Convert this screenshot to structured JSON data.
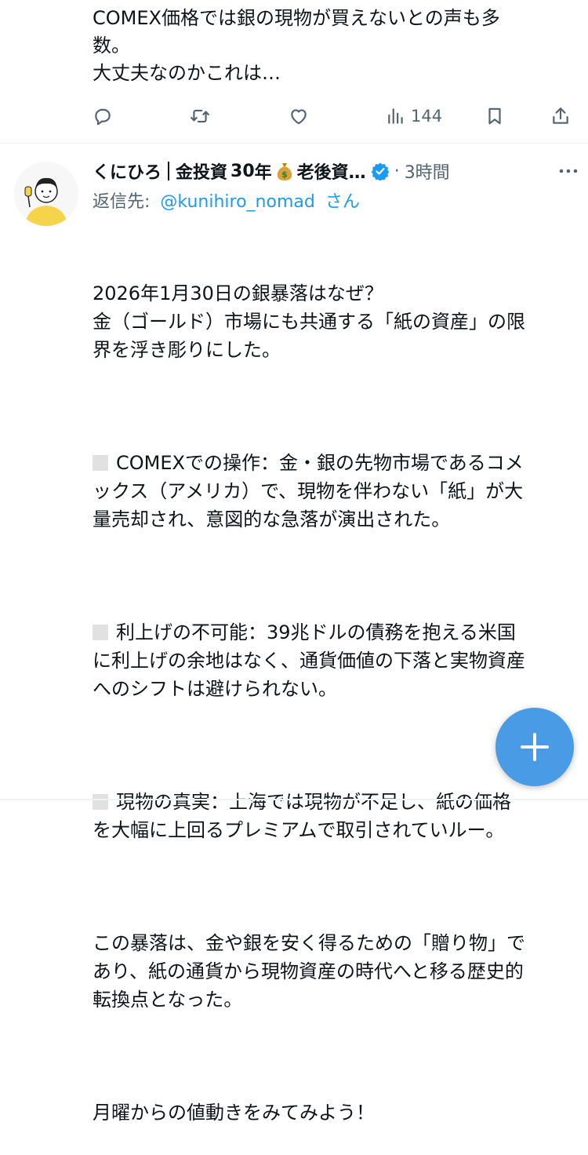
{
  "top_tweet": {
    "text": "COMEX価格では銀の現物が買えないとの声も多\n数。\n大丈夫なのかこれは…",
    "actions": {
      "reply_icon": "reply-icon",
      "retweet_icon": "retweet-icon",
      "like_icon": "heart-icon",
      "views_icon": "views-icon",
      "views_count": "144",
      "bookmark_icon": "bookmark-icon",
      "share_icon": "share-icon"
    }
  },
  "reply_tweet": {
    "display_name": "くにひろ",
    "name_tail_1": "金投資",
    "name_tail_2": "30",
    "name_tail_3": "年",
    "name_tail_4": "老後資…",
    "time": "3時間",
    "reply_to_label": "返信先:",
    "reply_to_handle": "@kunihiro_nomad",
    "reply_to_suffix": "さん",
    "paragraphs": [
      "2026年1月30日の銀暴落はなぜ？\n金（ゴールド）市場にも共通する「紙の資産」の限\n界を浮き彫りにした。",
      "COMEXでの操作：金・銀の先物市場であるコメ\nックス（アメリカ）で、現物を伴わない「紙」が大\n量売却され、意図的な急落が演出された。",
      "利上げの不可能：39兆ドルの債務を抱える米国\nに利上げの余地はなく、通貨価値の下落と実物資産\nへのシフトは避けられない。",
      "現物の真実：上海では現物が不足し、紙の価格\nを大幅に上回るプレミアムで取引されていルー。",
      "この暴落は、金や銀を安く得るための「贈り物」で\nあり、紙の通貨から現物資産の時代へと移る歴史的\n転換点となった。",
      "月曜からの値動きをみてみよう！"
    ]
  },
  "colors": {
    "accent": "#1d9bf0",
    "muted": "#536471",
    "fab": "#4a9be6"
  }
}
